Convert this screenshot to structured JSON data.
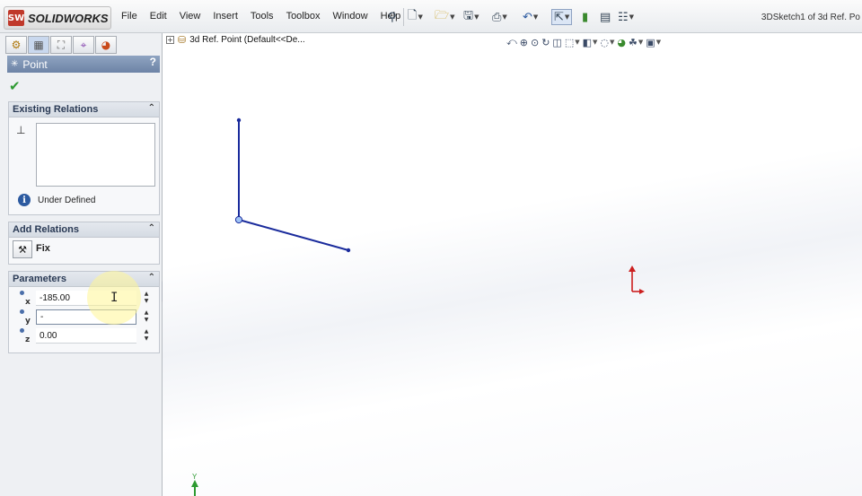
{
  "app": {
    "brand": "SOLIDWORKS",
    "logo_mark": "SW",
    "document_title": "3DSketch1 of 3d Ref. Po"
  },
  "menu": [
    "File",
    "Edit",
    "View",
    "Insert",
    "Tools",
    "Toolbox",
    "Window",
    "Help"
  ],
  "toolbar_icons": [
    "pin-icon",
    "new-document-icon",
    "open-icon",
    "save-icon",
    "print-icon",
    "undo-icon",
    "select-icon",
    "rebuild-icon",
    "file-properties-icon",
    "options-icon"
  ],
  "panel": {
    "tabs": [
      "feature-manager-tab",
      "property-manager-tab",
      "configuration-manager-tab",
      "dimxpert-tab",
      "display-manager-tab"
    ],
    "title": "Point",
    "help_label": "?",
    "existing_relations": {
      "header": "Existing Relations",
      "status": "Under Defined"
    },
    "add_relations": {
      "header": "Add Relations",
      "fix_label": "Fix"
    },
    "parameters": {
      "header": "Parameters",
      "rows": [
        {
          "axis": "x",
          "value": "-185.00"
        },
        {
          "axis": "y",
          "value": "-"
        },
        {
          "axis": "z",
          "value": "0.00"
        }
      ]
    }
  },
  "tree": {
    "root_label": "3d Ref. Point  (Default<<De..."
  },
  "triad": {
    "y_label": "Y"
  },
  "colors": {
    "sketch_line": "#1a2b9c",
    "panel_title": "#7a8fb0",
    "origin": "#cc1f1f",
    "triad_y": "#2e9a32"
  }
}
